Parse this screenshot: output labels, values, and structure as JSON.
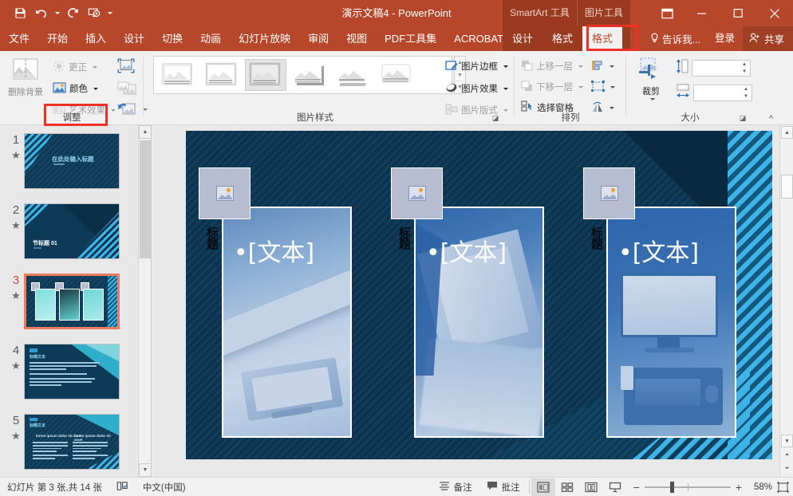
{
  "window": {
    "title": "演示文稿4 - PowerPoint",
    "quick_access": [
      {
        "name": "save-icon",
        "label": "保存"
      },
      {
        "name": "undo-icon",
        "label": "撤消"
      },
      {
        "name": "redo-icon",
        "label": "恢复"
      },
      {
        "name": "start-slideshow-icon",
        "label": "从头开始"
      },
      {
        "name": "customize-qat-icon",
        "label": "自定义快速访问工具栏"
      }
    ],
    "controls": [
      {
        "name": "ribbon-display-options-icon",
        "glyph": "▣"
      },
      {
        "name": "minimize-icon",
        "glyph": "—"
      },
      {
        "name": "maximize-icon",
        "glyph": "☐"
      },
      {
        "name": "close-icon",
        "glyph": "✕"
      }
    ]
  },
  "tabs": {
    "main": [
      "文件",
      "开始",
      "插入",
      "设计",
      "切换",
      "动画",
      "幻灯片放映",
      "审阅",
      "视图",
      "PDF工具集",
      "ACROBAT"
    ],
    "contextual_groups": [
      "SmartArt 工具",
      "图片工具"
    ],
    "contextual_tabs": [
      "设计",
      "格式",
      "格式"
    ],
    "active_tab": "格式",
    "tell_me": "告诉我...",
    "sign_in": "登录",
    "share": "共享"
  },
  "ribbon": {
    "groups": [
      {
        "name": "adjust",
        "label": "调整",
        "buttons": [
          {
            "name": "remove-background-button",
            "label": "删除背景",
            "enabled": false
          },
          {
            "name": "corrections-button",
            "label": "更正",
            "enabled": false
          },
          {
            "name": "color-button",
            "label": "颜色",
            "enabled": true,
            "highlighted": true
          },
          {
            "name": "artistic-effects-button",
            "label": "艺术效果",
            "enabled": false
          },
          {
            "name": "compress-pictures-icon",
            "label": "压缩图片"
          },
          {
            "name": "change-picture-icon",
            "label": "更改图片"
          },
          {
            "name": "reset-picture-icon",
            "label": "重设图片"
          }
        ]
      },
      {
        "name": "picture-styles",
        "label": "图片样式",
        "gallery_count": 6,
        "gallery_selected_index": 2,
        "buttons": [
          {
            "name": "picture-border-button",
            "label": "图片边框",
            "enabled": true
          },
          {
            "name": "picture-effects-button",
            "label": "图片效果",
            "enabled": true
          },
          {
            "name": "picture-layout-button",
            "label": "图片版式",
            "enabled": false
          }
        ]
      },
      {
        "name": "arrange",
        "label": "排列",
        "buttons": [
          {
            "name": "bring-forward-button",
            "label": "上移一层",
            "enabled": false
          },
          {
            "name": "send-backward-button",
            "label": "下移一层",
            "enabled": false
          },
          {
            "name": "selection-pane-button",
            "label": "选择窗格",
            "enabled": true
          },
          {
            "name": "align-button",
            "label": "对齐"
          },
          {
            "name": "group-button",
            "label": "组合"
          },
          {
            "name": "rotate-button",
            "label": "旋转"
          }
        ]
      },
      {
        "name": "size",
        "label": "大小",
        "buttons": [
          {
            "name": "crop-button",
            "label": "裁剪",
            "enabled": true
          }
        ],
        "fields": [
          {
            "name": "shape-height-field",
            "label": "高度",
            "value": ""
          },
          {
            "name": "shape-width-field",
            "label": "宽度",
            "value": ""
          }
        ]
      }
    ],
    "collapse_label": "^"
  },
  "slides_pane": {
    "slides": [
      {
        "number": "1",
        "title": "在此处输入标题",
        "kind": "title",
        "selected": false
      },
      {
        "number": "2",
        "title": "节标题 01",
        "kind": "section",
        "selected": false
      },
      {
        "number": "3",
        "title": "",
        "kind": "three-picture",
        "selected": true
      },
      {
        "number": "4",
        "title": "标题文本",
        "kind": "bullets",
        "selected": false
      },
      {
        "number": "5",
        "title": "标题文本",
        "kind": "two-column",
        "selected": false
      }
    ]
  },
  "slide_canvas": {
    "placeholders": [
      {
        "name": "picture-placeholder-1",
        "text": "•[文本]"
      },
      {
        "name": "picture-placeholder-2",
        "text": "•[文本]"
      },
      {
        "name": "picture-placeholder-3",
        "text": "•[文本]"
      }
    ],
    "vertical_marks": [
      "标题",
      "标题",
      "标题"
    ],
    "theme_colors": {
      "slide_bg": "#0b3450",
      "dark_corner": "#08293f",
      "accent_cyan": "#3db3e8",
      "photo_tint": "#5d86b8"
    }
  },
  "status_bar": {
    "slide_counter": "幻灯片 第 3 张,共 14 张",
    "language_icon": "proofing-icon",
    "language": "中文(中国)",
    "notes": "备注",
    "comments": "批注",
    "views": [
      {
        "name": "normal-view-button",
        "label": "普通视图",
        "active": true
      },
      {
        "name": "slide-sorter-view-button",
        "label": "幻灯片浏览",
        "active": false
      },
      {
        "name": "reading-view-button",
        "label": "阅读视图",
        "active": false
      },
      {
        "name": "slideshow-view-button",
        "label": "幻灯片放映",
        "active": false
      }
    ],
    "zoom_out": "−",
    "zoom_in": "+",
    "zoom_level": "58%",
    "fit_button": "fit-slide-icon"
  }
}
